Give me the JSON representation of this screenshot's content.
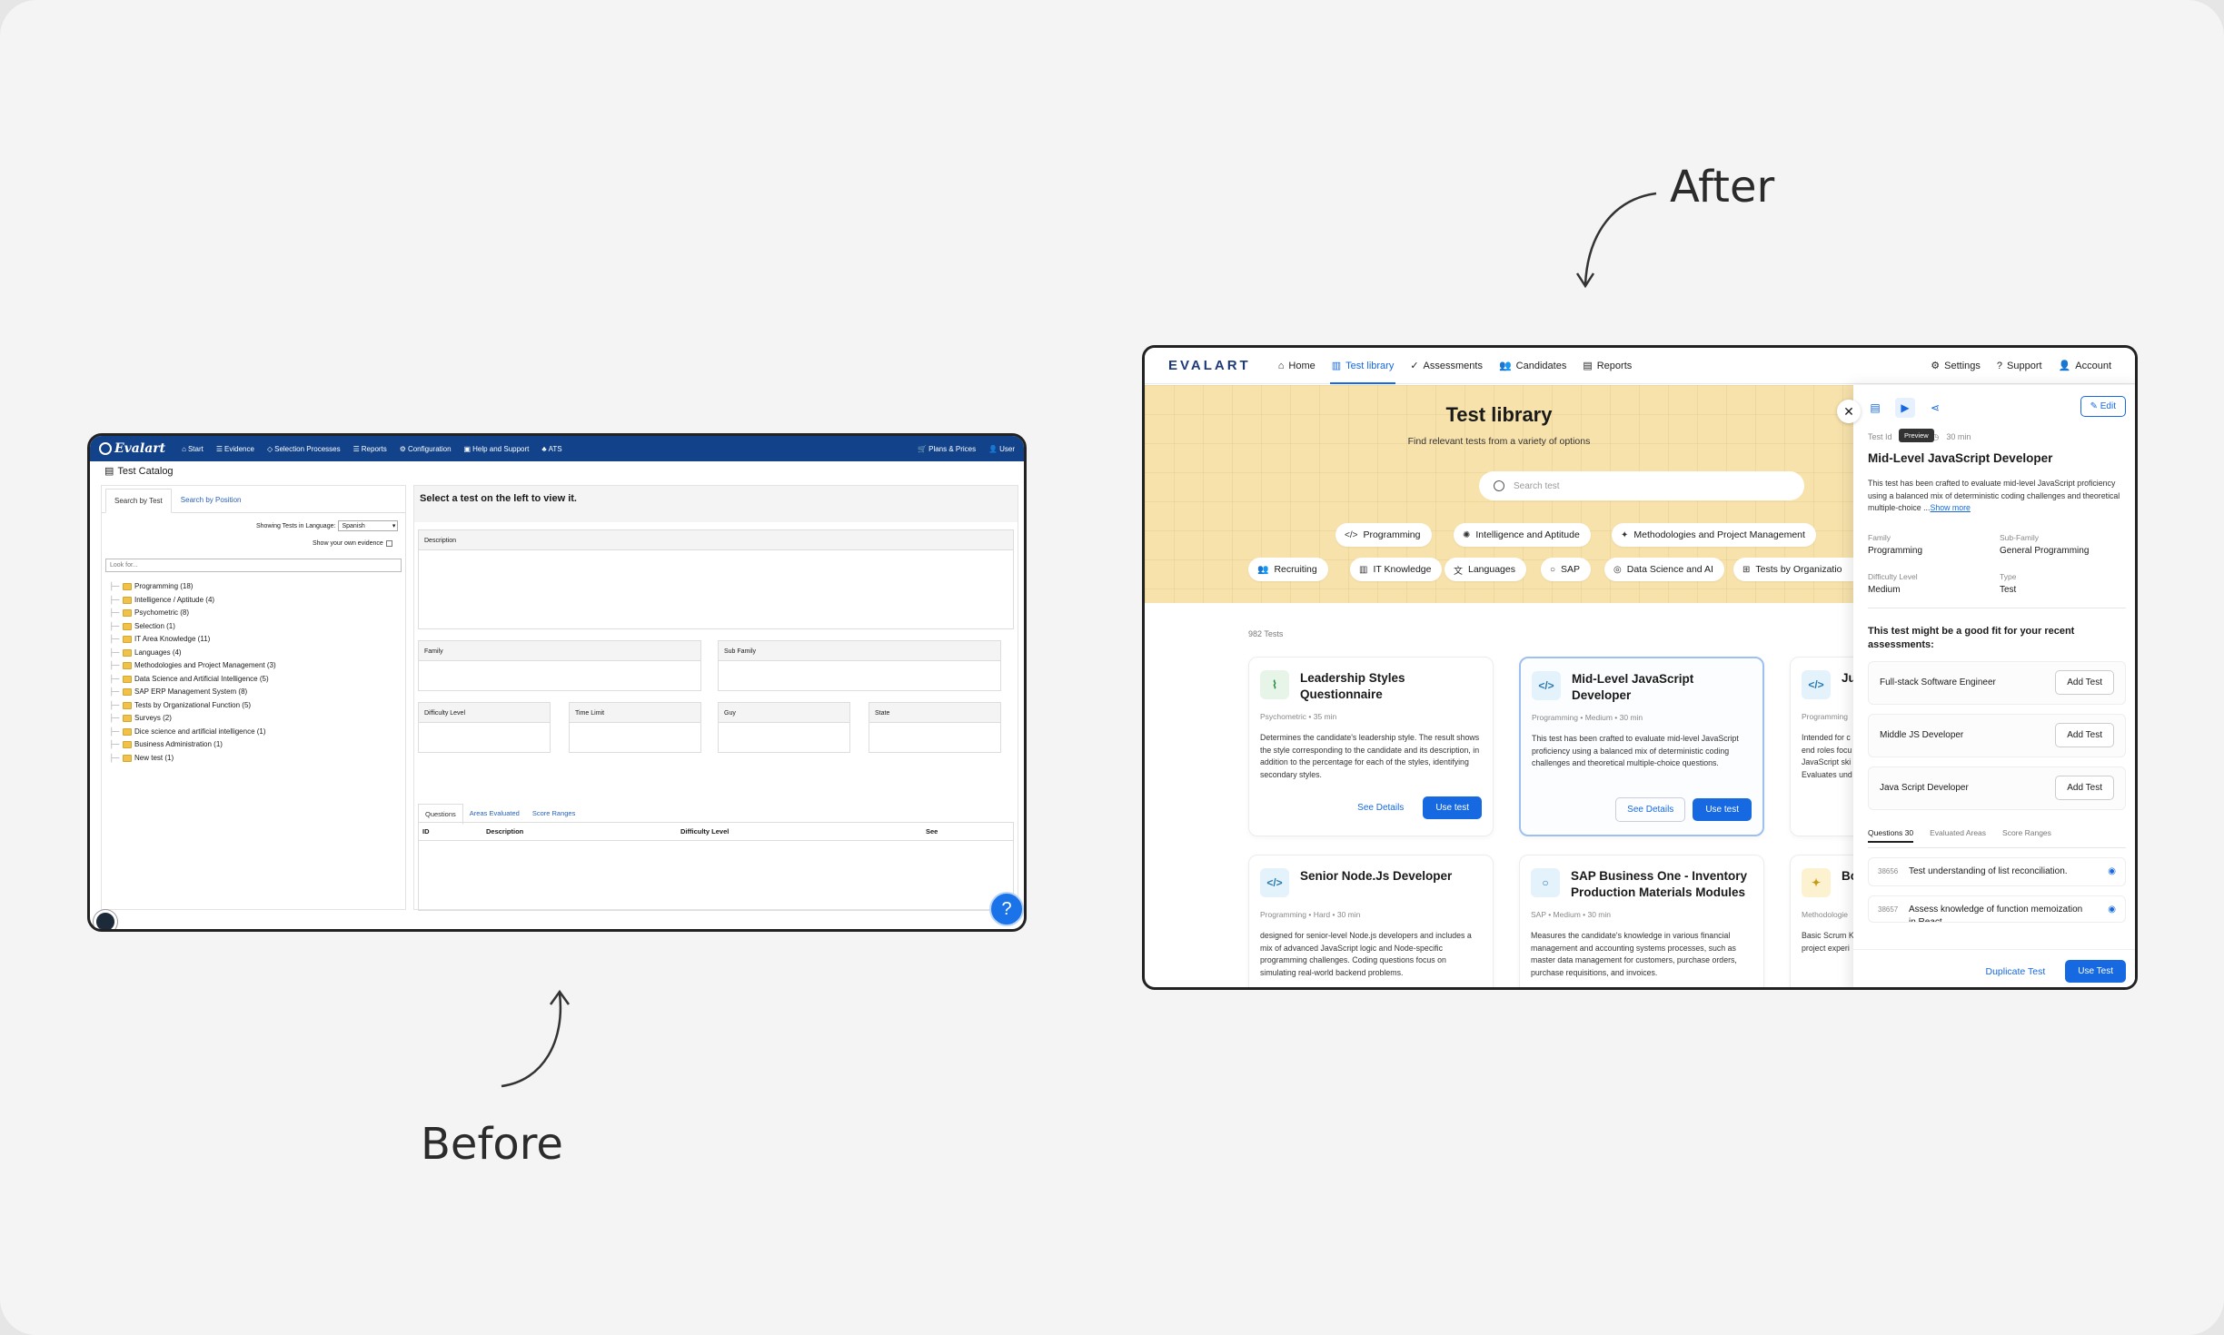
{
  "labels": {
    "after": "After",
    "before": "Before"
  },
  "before": {
    "logo": "Evalart",
    "nav": [
      "Start",
      "Evidence",
      "Selection Processes",
      "Reports",
      "Configuration",
      "Help and Support",
      "ATS"
    ],
    "nav_right": [
      "Plans & Prices",
      "User"
    ],
    "catalog_title": "Test Catalog",
    "tabs": [
      "Search by Test",
      "Search by Position"
    ],
    "language_label": "Showing Tests in Language:",
    "language_value": "Spanish",
    "own_evidence": "Show your own evidence",
    "search_placeholder": "Look for...",
    "tree": [
      "Programming (18)",
      "Intelligence / Aptitude (4)",
      "Psychometric (8)",
      "Selection (1)",
      "IT Area Knowledge (11)",
      "Languages (4)",
      "Methodologies and Project Management (3)",
      "Data Science and Artificial Intelligence (5)",
      "SAP ERP Management System (8)",
      "Tests by Organizational Function (5)",
      "Surveys (2)",
      "Dice science and artificial intelligence (1)",
      "Business Administration (1)",
      "New test (1)"
    ],
    "select_prompt": "Select a test on the left to view it.",
    "fields": {
      "description": "Description",
      "family": "Family",
      "sub_family": "Sub Family",
      "difficulty": "Difficulty Level",
      "time": "Time Limit",
      "guy": "Guy",
      "state": "State"
    },
    "qtabs": [
      "Questions",
      "Areas Evaluated",
      "Score Ranges"
    ],
    "table_headers": [
      "ID",
      "Description",
      "Difficulty Level",
      "See"
    ],
    "help": "?"
  },
  "after": {
    "logo": "EVALART",
    "nav": [
      "Home",
      "Test library",
      "Assessments",
      "Candidates",
      "Reports"
    ],
    "nav_right": [
      "Settings",
      "Support",
      "Account"
    ],
    "hero_title": "Test library",
    "hero_sub": "Find relevant tests from a variety of options",
    "search_placeholder": "Search test",
    "chips_row1": [
      "Programming",
      "Intelligence and Aptitude",
      "Methodologies and Project Management"
    ],
    "chips_row2": [
      "Recruiting",
      "IT Knowledge",
      "Languages",
      "SAP",
      "Data Science and AI",
      "Tests by Organizatio"
    ],
    "count": "982 Tests",
    "cards": [
      {
        "title": "Leadership Styles Questionnaire",
        "meta": "Psychometric  •  35 min",
        "desc": "Determines the candidate's leadership style. The result shows the style corresponding to the candidate and its description, in addition to the percentage for each of the styles, identifying secondary styles.",
        "details": "See Details",
        "use": "Use test",
        "icon": "~"
      },
      {
        "title": "Mid-Level JavaScript Developer",
        "meta": "Programming  •  Medium  •  30 min",
        "desc": "This test has been crafted to evaluate mid-level JavaScript proficiency using a balanced mix of deterministic coding challenges and theoretical multiple-choice questions.",
        "details": "See Details",
        "use": "Use test",
        "icon": "</>"
      },
      {
        "title": "Ju",
        "meta": "Programming",
        "desc": "Intended for c end roles focu JavaScript ski Evaluates und",
        "icon": "</>"
      },
      {
        "title": "Senior Node.Js Developer",
        "meta": "Programming  •  Hard  •  30 min",
        "desc": "designed for senior-level Node.js developers and includes a mix of advanced JavaScript logic and Node-specific programming challenges. Coding questions focus on simulating real-world backend problems.",
        "icon": "</>"
      },
      {
        "title": "SAP Business One - Inventory Production Materials Modules",
        "meta": "SAP  •  Medium  •  30 min",
        "desc": "Measures the candidate's knowledge in various financial management and accounting systems processes, such as master data management for customers, purchase orders, purchase requisitions, and invoices.",
        "icon": "Q"
      },
      {
        "title": "Bo",
        "meta": "Methodologie",
        "desc": "Basic Scrum K project experi",
        "icon": "✦"
      }
    ],
    "panel": {
      "tooltip": "Preview",
      "edit": "Edit",
      "test_id": "Test Id",
      "duration": "30 min",
      "title": "Mid-Level JavaScript Developer",
      "desc": "This test has been crafted to evaluate mid-level JavaScript proficiency using a balanced mix of deterministic coding challenges and theoretical multiple-choice ...",
      "show_more": "Show more",
      "family_label": "Family",
      "family": "Programming",
      "subfamily_label": "Sub-Family",
      "subfamily": "General Programming",
      "difficulty_label": "Difficulty Level",
      "difficulty": "Medium",
      "type_label": "Type",
      "type": "Test",
      "fit_title": "This test might be a good fit for your recent assessments:",
      "assessments": [
        "Full-stack Software Engineer",
        "Middle JS Developer",
        "Java Script Developer"
      ],
      "add_test": "Add Test",
      "tabs": [
        "Questions",
        "Evaluated Areas",
        "Score Ranges"
      ],
      "questions_count": "30",
      "questions": [
        {
          "id": "38656",
          "text": "Test understanding of list reconciliation."
        },
        {
          "id": "38657",
          "text": "Assess knowledge of function memoization in React"
        }
      ],
      "duplicate": "Duplicate Test",
      "use": "Use Test"
    }
  }
}
